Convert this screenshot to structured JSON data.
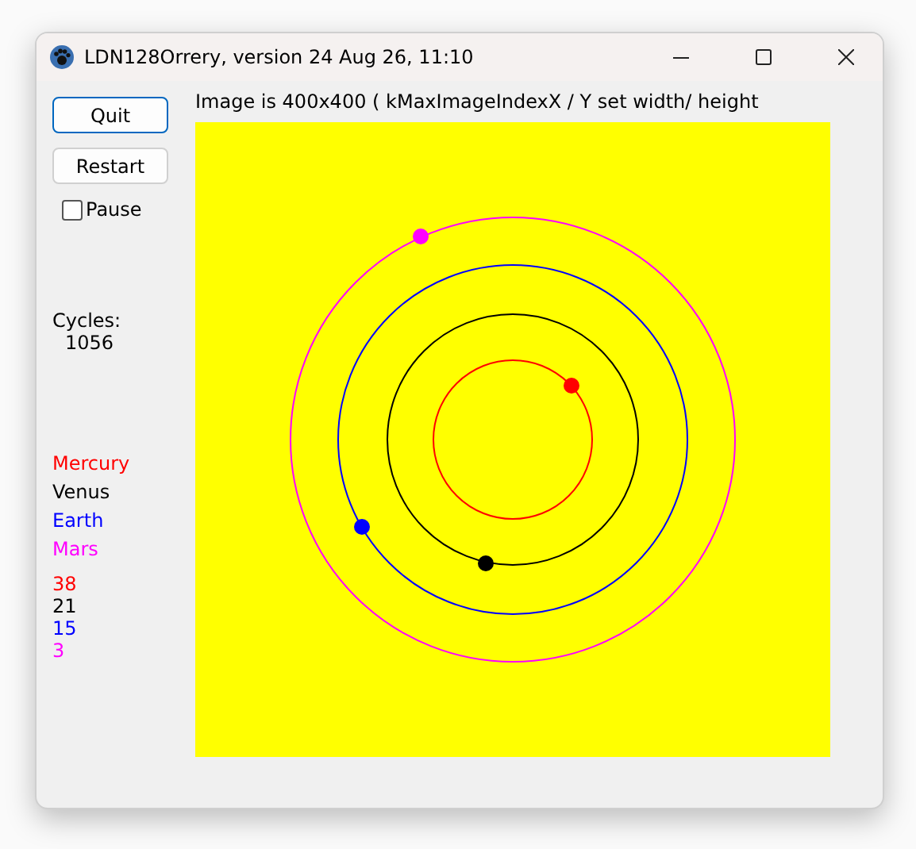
{
  "window": {
    "title": "LDN128Orrery, version 24 Aug 26, 11:10"
  },
  "buttons": [
    {
      "label": "Quit",
      "focused": true
    },
    {
      "label": "Restart",
      "focused": false
    }
  ],
  "pause": {
    "label": "Pause",
    "checked": false
  },
  "cycles": {
    "label": "Cycles:",
    "value": "1056"
  },
  "planets": [
    {
      "name": "Mercury",
      "color": "#ff0000",
      "count": "38"
    },
    {
      "name": "Venus",
      "color": "#000000",
      "count": "21"
    },
    {
      "name": "Earth",
      "color": "#0000ff",
      "count": "15"
    },
    {
      "name": "Mars",
      "color": "#ff00ff",
      "count": "3"
    }
  ],
  "image_caption": "Image is 400x400 ( kMaxImageIndexX / Y set width/ height"
}
